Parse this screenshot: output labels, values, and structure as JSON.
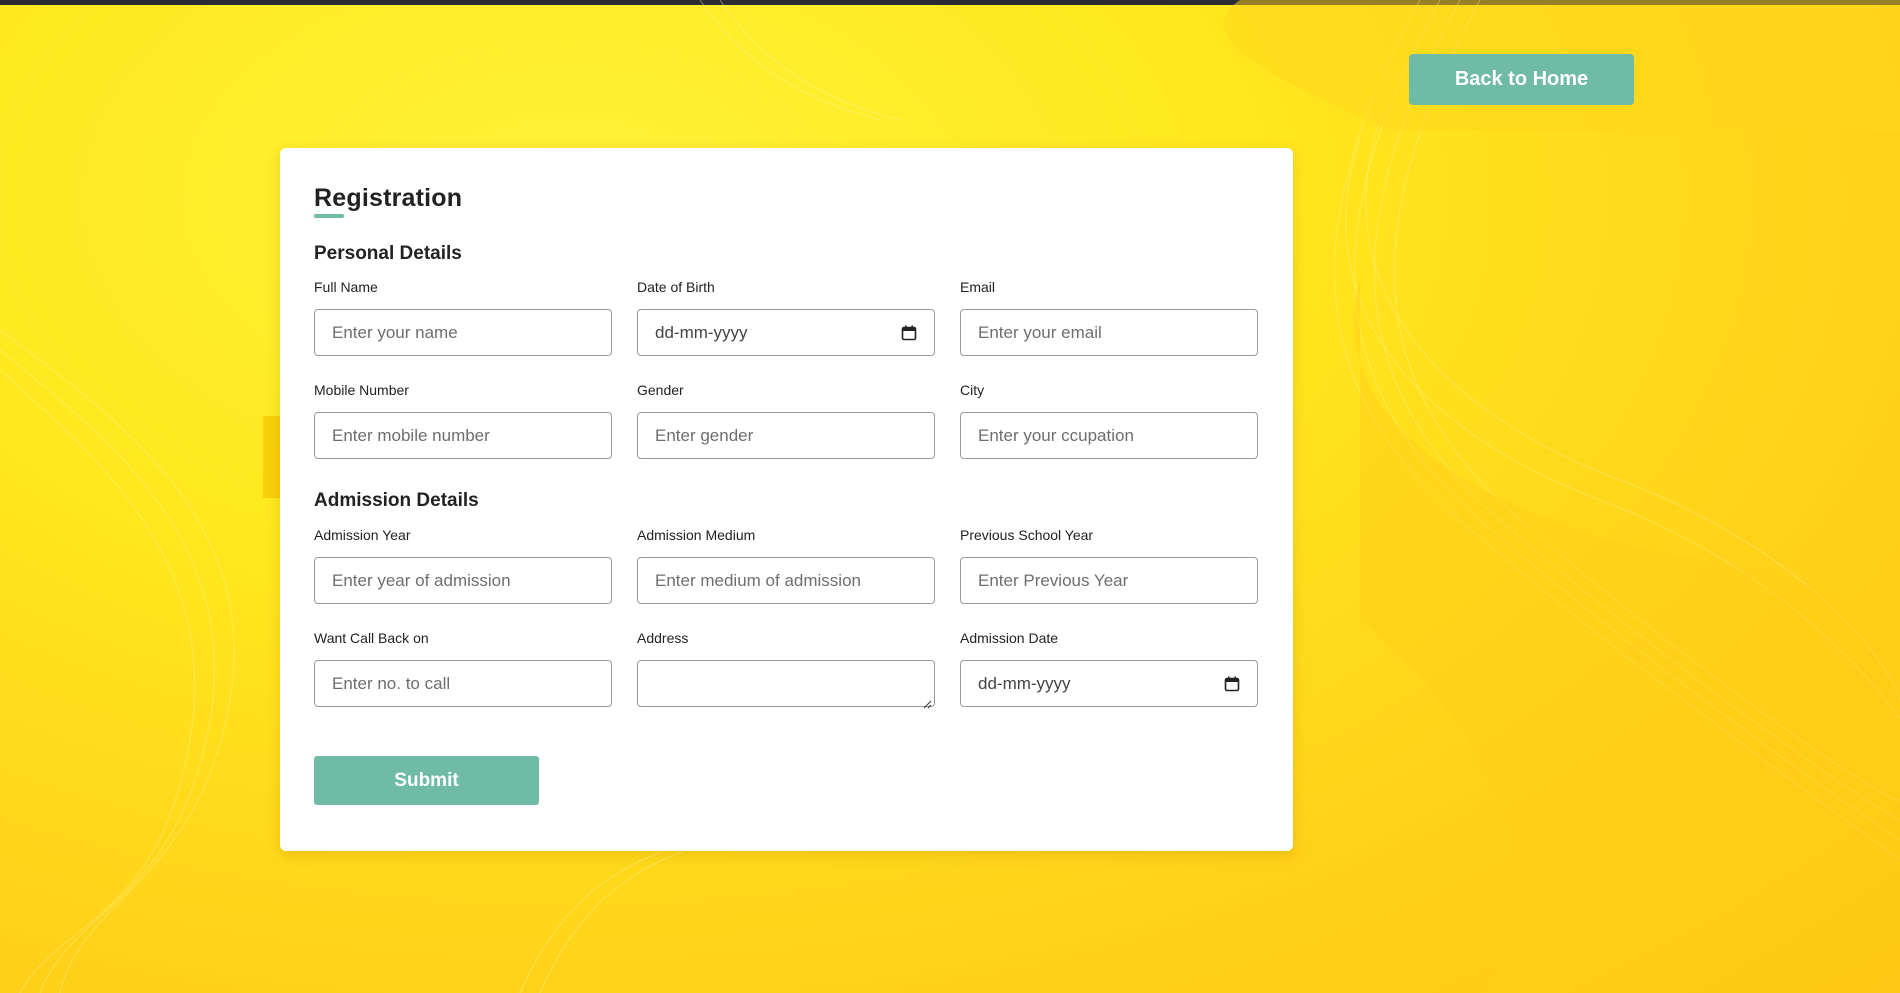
{
  "colors": {
    "accent": "#6fbba6",
    "background": "#ffe81e",
    "card": "#ffffff",
    "topbar": "#2b2b33"
  },
  "nav": {
    "back_label": "Back to Home"
  },
  "form": {
    "title": "Registration",
    "personal": {
      "heading": "Personal Details",
      "fields": [
        {
          "label": "Full Name",
          "placeholder": "Enter your name"
        },
        {
          "label": "Date of Birth",
          "value": "dd-mm-yyyy",
          "icon": "calendar-icon"
        },
        {
          "label": "Email",
          "placeholder": "Enter your email"
        },
        {
          "label": "Mobile Number",
          "placeholder": "Enter mobile number"
        },
        {
          "label": "Gender",
          "placeholder": "Enter gender"
        },
        {
          "label": "City",
          "placeholder": "Enter your ccupation"
        }
      ]
    },
    "admission": {
      "heading": "Admission Details",
      "fields": [
        {
          "label": "Admission Year",
          "placeholder": "Enter year of admission"
        },
        {
          "label": "Admission Medium",
          "placeholder": "Enter medium of admission"
        },
        {
          "label": "Previous School Year",
          "placeholder": "Enter Previous Year"
        },
        {
          "label": "Want Call Back on",
          "placeholder": "Enter no. to call"
        },
        {
          "label": "Address",
          "placeholder": ""
        },
        {
          "label": "Admission Date",
          "value": "dd-mm-yyyy",
          "icon": "calendar-icon"
        }
      ]
    },
    "submit_label": "Submit"
  }
}
